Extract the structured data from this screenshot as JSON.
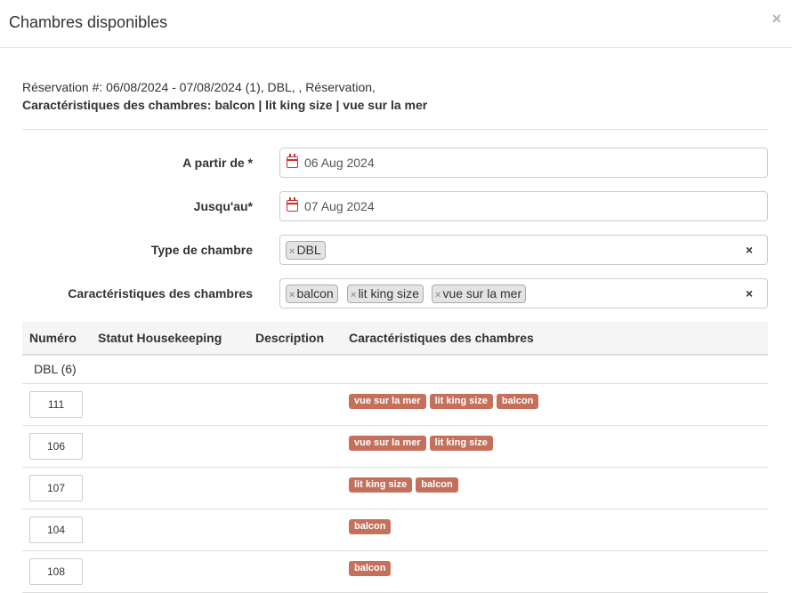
{
  "modal": {
    "title": "Chambres disponibles",
    "close_label": "×"
  },
  "info": {
    "line1": "Réservation #: 06/08/2024 - 07/08/2024 (1), DBL, , Réservation,",
    "line2": "Caractéristiques des chambres: balcon | lit king size | vue sur la mer"
  },
  "form": {
    "from": {
      "label": "A partir de *",
      "value": "06 Aug 2024",
      "icon": "calendar-icon"
    },
    "to": {
      "label": "Jusqu'au*",
      "value": "07 Aug 2024",
      "icon": "calendar-icon"
    },
    "room_type": {
      "label": "Type de chambre",
      "chips": [
        "DBL"
      ],
      "chip_remove": "×",
      "clear": "×"
    },
    "features": {
      "label": "Caractéristiques des chambres",
      "chips": [
        "balcon",
        "lit king size",
        "vue sur la mer"
      ],
      "chip_remove": "×",
      "clear": "×"
    }
  },
  "table": {
    "headers": [
      "Numéro",
      "Statut Housekeeping",
      "Description",
      "Caractéristiques des chambres"
    ],
    "group": "DBL (6)",
    "rows": [
      {
        "number": "111",
        "features": [
          "vue sur la mer",
          "lit king size",
          "balcon"
        ]
      },
      {
        "number": "106",
        "features": [
          "vue sur la mer",
          "lit king size"
        ]
      },
      {
        "number": "107",
        "features": [
          "lit king size",
          "balcon"
        ]
      },
      {
        "number": "104",
        "features": [
          "balcon"
        ]
      },
      {
        "number": "108",
        "features": [
          "balcon"
        ]
      }
    ]
  },
  "colors": {
    "feature_label": "#c5705b",
    "calendar_icon": "#c9302c"
  }
}
